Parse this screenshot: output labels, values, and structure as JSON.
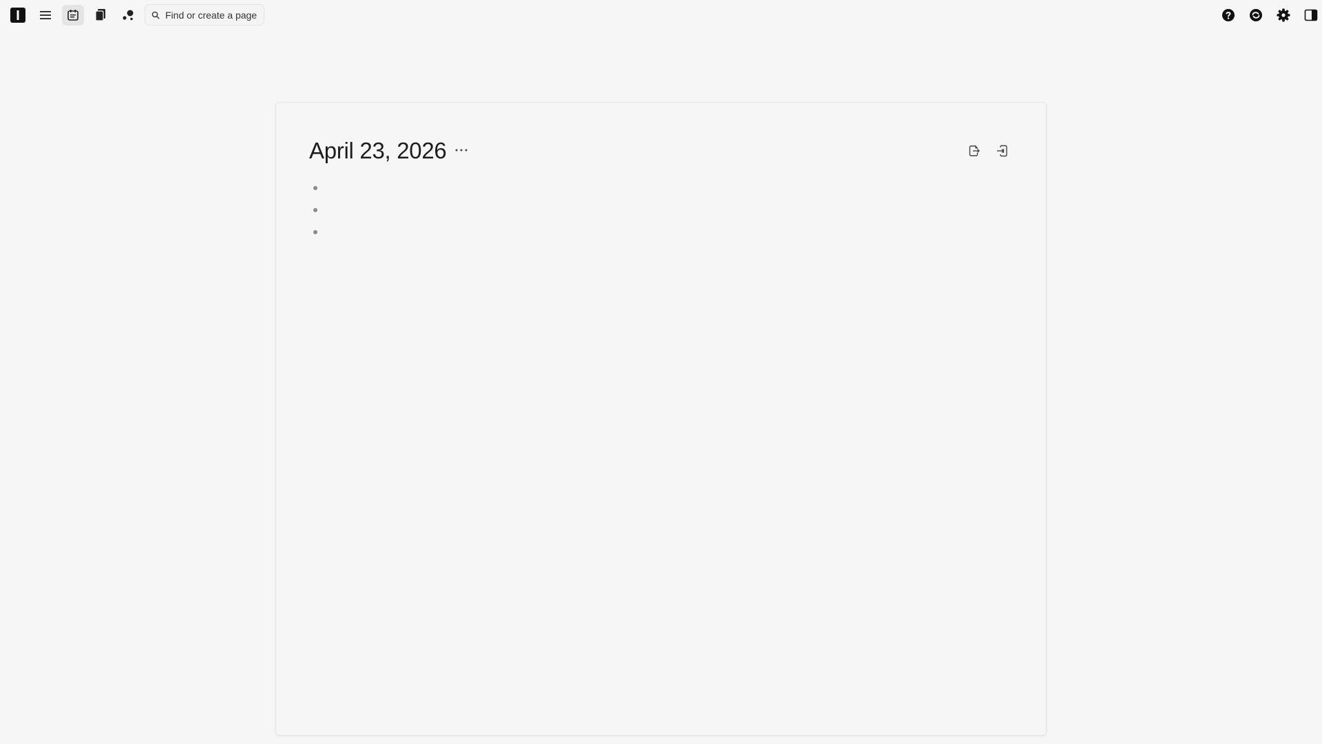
{
  "topbar": {
    "logo_icon": "app-logo-icon",
    "menu_icon": "hamburger-menu-icon",
    "journal_icon": "daily-journal-icon",
    "pages_icon": "pages-icon",
    "graph_icon": "graph-view-icon",
    "search": {
      "placeholder": "Find or create a page",
      "icon": "search-icon"
    },
    "help_icon": "help-icon",
    "sync_icon": "sync-icon",
    "settings_icon": "settings-gear-icon",
    "sidebar_icon": "right-sidebar-toggle-icon"
  },
  "page": {
    "title": "April 23, 2026",
    "more_label": "···",
    "actions": [
      "export-icon",
      "import-icon"
    ],
    "bullets": [
      {
        "text": ""
      },
      {
        "text": ""
      },
      {
        "text": ""
      }
    ]
  },
  "colors": {
    "background": "#f6f6f6",
    "active_tab": "#e4e4e4",
    "text": "#1d1d1d",
    "bullet": "#8a8a8a"
  }
}
